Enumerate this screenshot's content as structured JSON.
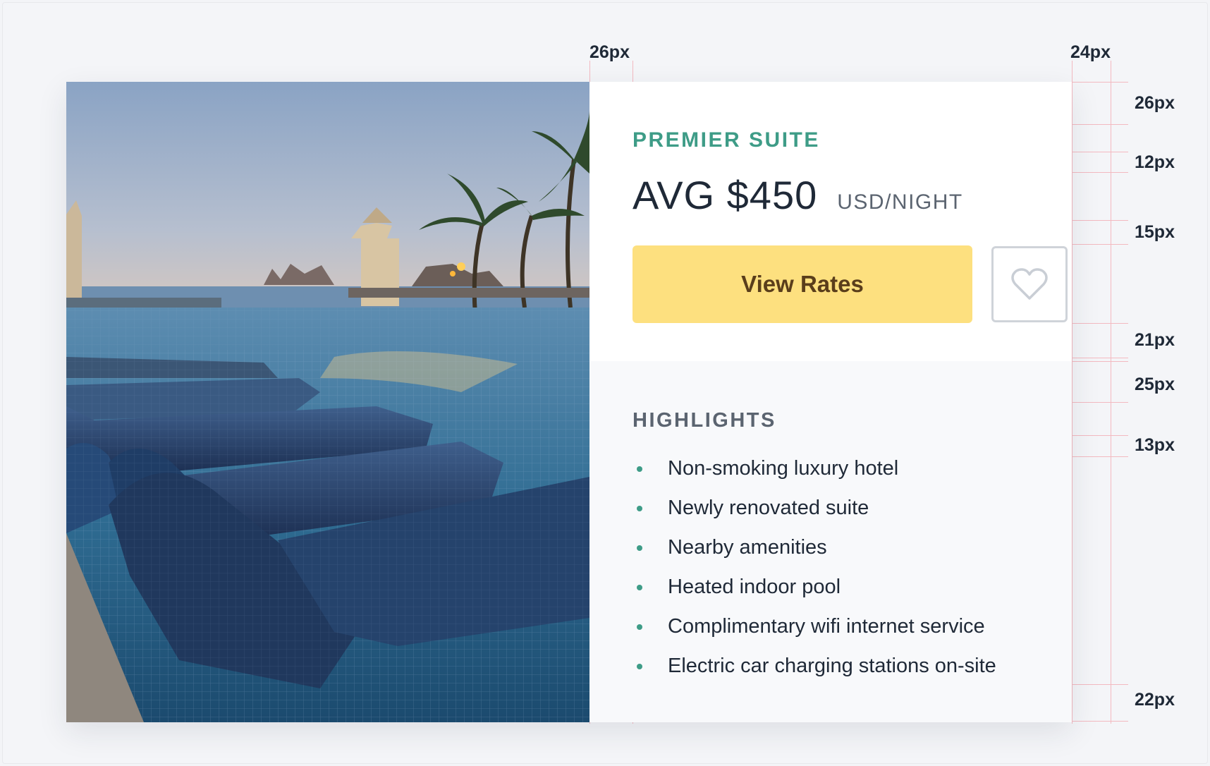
{
  "annotations": {
    "left_padding": "26px",
    "right_padding": "24px",
    "top_padding": "26px",
    "eyebrow_gap": "12px",
    "price_gap": "15px",
    "button_gap": "21px",
    "section_gap": "25px",
    "heading_gap": "13px",
    "bottom_padding": "22px"
  },
  "card": {
    "image_alt": "Hotel infinity pool with tiled sun loungers and palm trees by the ocean",
    "eyebrow": "PREMIER SUITE",
    "price": "AVG $450",
    "unit": "USD/NIGHT",
    "view_rates_label": "View Rates",
    "favorite_icon": "heart-outline-icon"
  },
  "highlights": {
    "title": "HIGHLIGHTS",
    "items": [
      "Non-smoking luxury hotel",
      "Newly renovated suite",
      "Nearby amenities",
      "Heated indoor pool",
      "Complimentary wifi internet service",
      "Electric car charging stations on-site"
    ]
  },
  "colors": {
    "accent": "#3e9c87",
    "button": "#fde07f",
    "guide": "#f3b9c0",
    "text": "#1f2937"
  }
}
